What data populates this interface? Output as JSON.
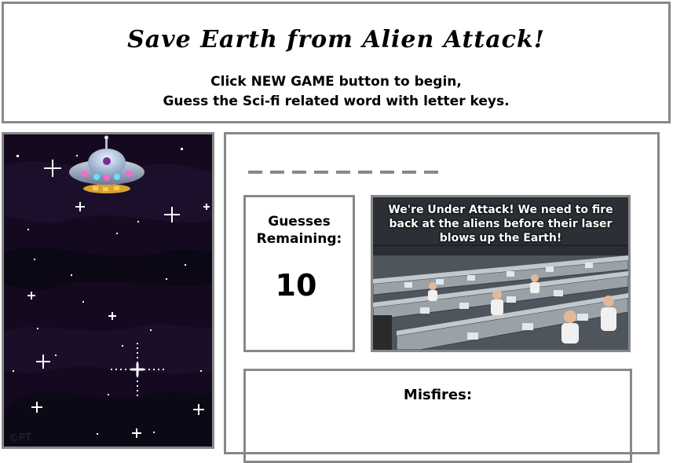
{
  "header": {
    "title": "Save Earth from Alien Attack!",
    "instruction_line1": "Click NEW GAME button to begin,",
    "instruction_line2": "Guess the Sci-fi related word with letter keys."
  },
  "space_panel": {
    "watermark": "©PT"
  },
  "game": {
    "word_length": 9,
    "guesses_label": "Guesses Remaining:",
    "guesses_remaining": "10",
    "scene_message": "We're Under Attack! We need to fire back at the aliens before their laser blows up the Earth!",
    "misfires_label": "Misfires:",
    "misfires": ""
  },
  "colors": {
    "border": "#888888",
    "space": "#14091f",
    "blank": "#888888"
  }
}
